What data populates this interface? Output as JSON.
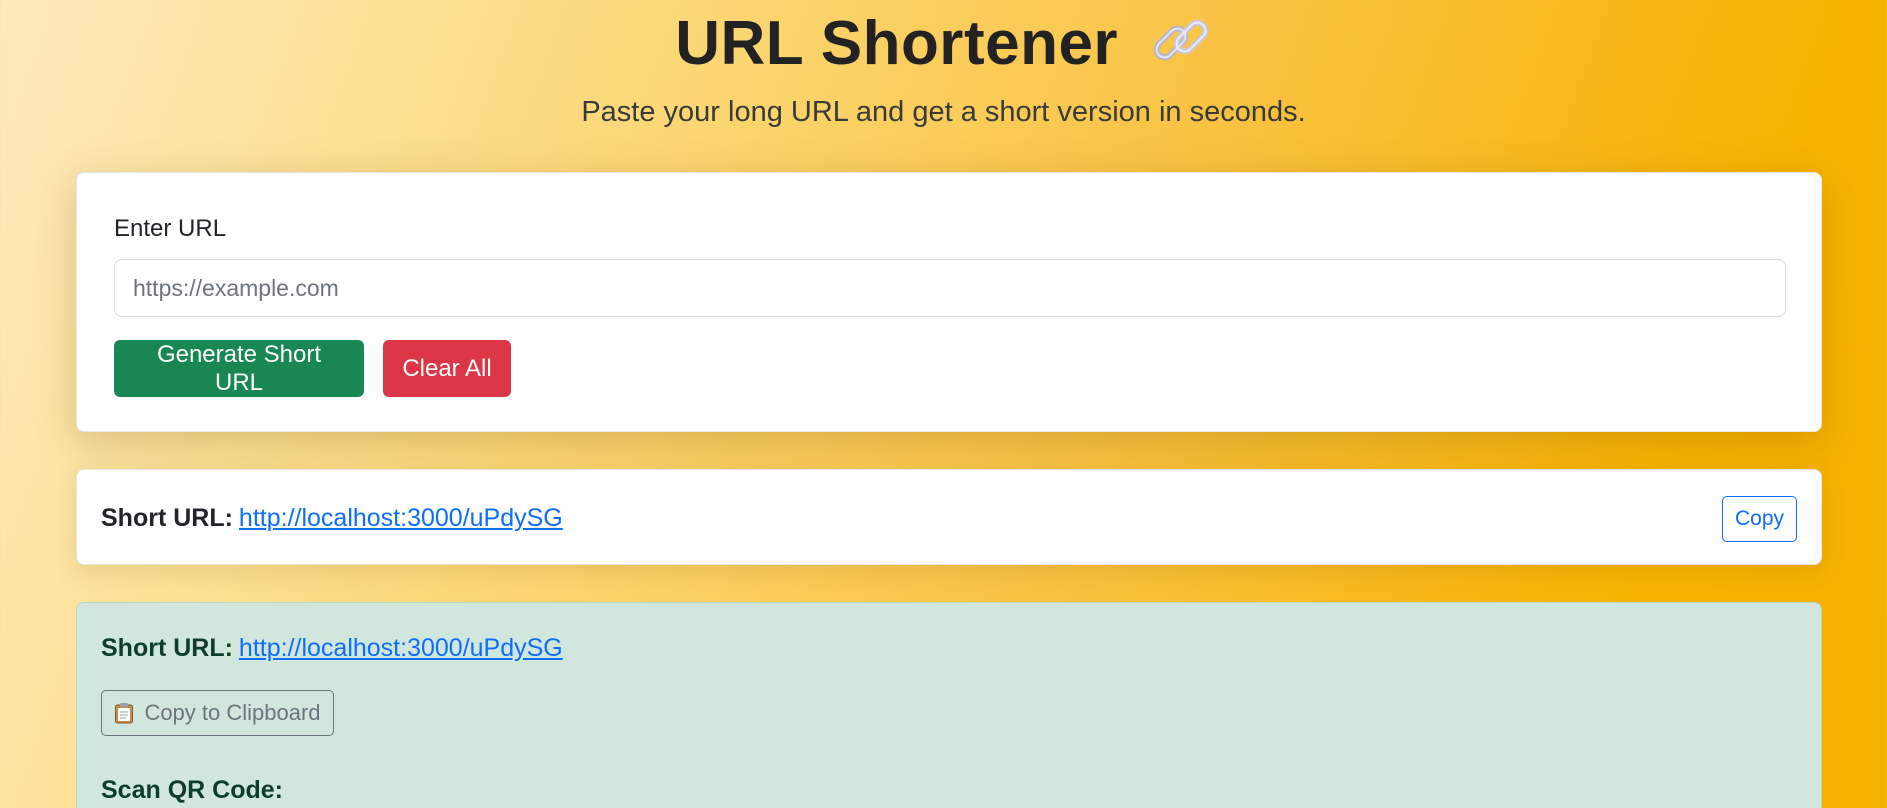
{
  "header": {
    "title": "URL Shortener",
    "subtitle": "Paste your long URL and get a short version in seconds."
  },
  "form": {
    "label": "Enter URL",
    "input_placeholder": "https://example.com",
    "input_value": "",
    "generate_label": "Generate Short URL",
    "clear_label": "Clear All"
  },
  "result": {
    "short_label": "Short URL:",
    "short_url": "http://localhost:3000/uPdySG",
    "copy_label": "Copy"
  },
  "success": {
    "short_label": "Short URL:",
    "short_url": "http://localhost:3000/uPdySG",
    "clipboard_label": "Copy to Clipboard",
    "qr_label": "Scan QR Code:"
  },
  "icons": {
    "title_icon": "link-chain-icon",
    "clipboard_icon": "clipboard-icon"
  },
  "colors": {
    "success": "#198754",
    "danger": "#dc3545",
    "primary": "#0d6efd",
    "success_bg": "#d1e7dd"
  }
}
